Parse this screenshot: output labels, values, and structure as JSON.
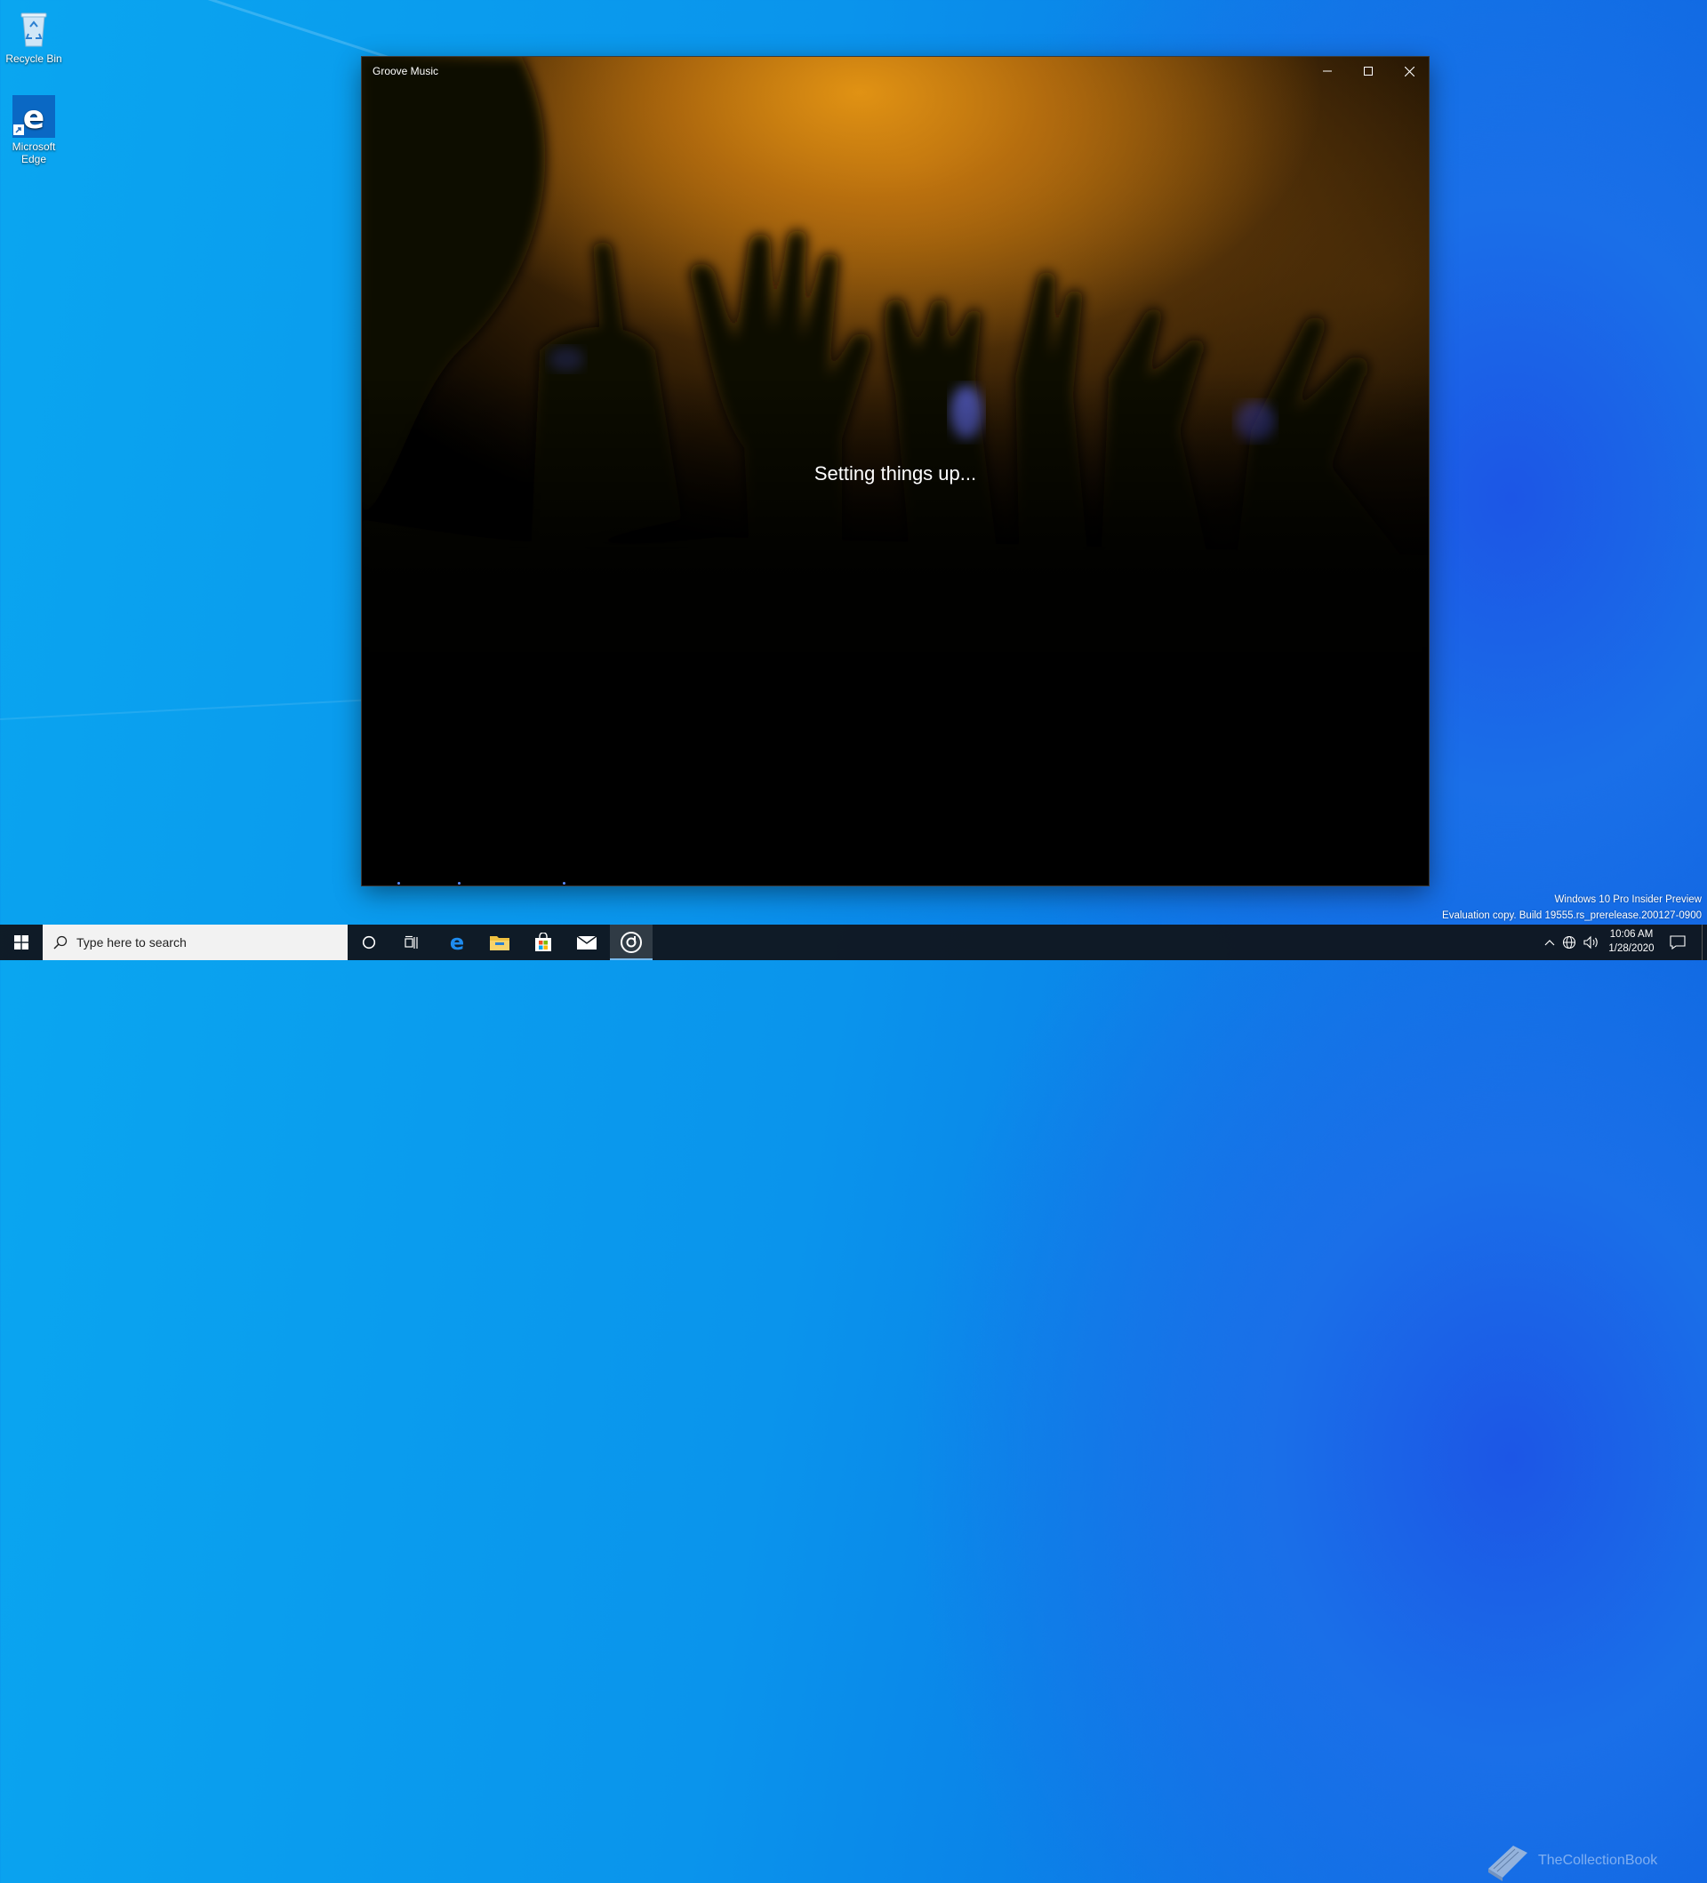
{
  "desktop": {
    "icons": [
      {
        "label": "Recycle Bin"
      },
      {
        "label": "Microsoft Edge"
      }
    ]
  },
  "window": {
    "title": "Groove Music",
    "status_text": "Setting things up...",
    "controls": {
      "minimize_icon": "minimize-icon",
      "maximize_icon": "maximize-icon",
      "close_icon": "close-icon"
    }
  },
  "watermark": {
    "line1": "Windows 10 Pro Insider Preview",
    "line2": "Evaluation copy. Build 19555.rs_prerelease.200127-0900"
  },
  "taskbar": {
    "search_placeholder": "Type here to search",
    "apps": [
      "Microsoft Edge",
      "File Explorer",
      "Microsoft Store",
      "Mail",
      "Groove Music"
    ],
    "clock": {
      "time": "10:06 AM",
      "date": "1/28/2020"
    },
    "overlay_text": "TheCollectionBook"
  },
  "colors": {
    "accent": "#0078d7",
    "taskbar": "#101820",
    "active_indicator": "#76b9ed"
  }
}
